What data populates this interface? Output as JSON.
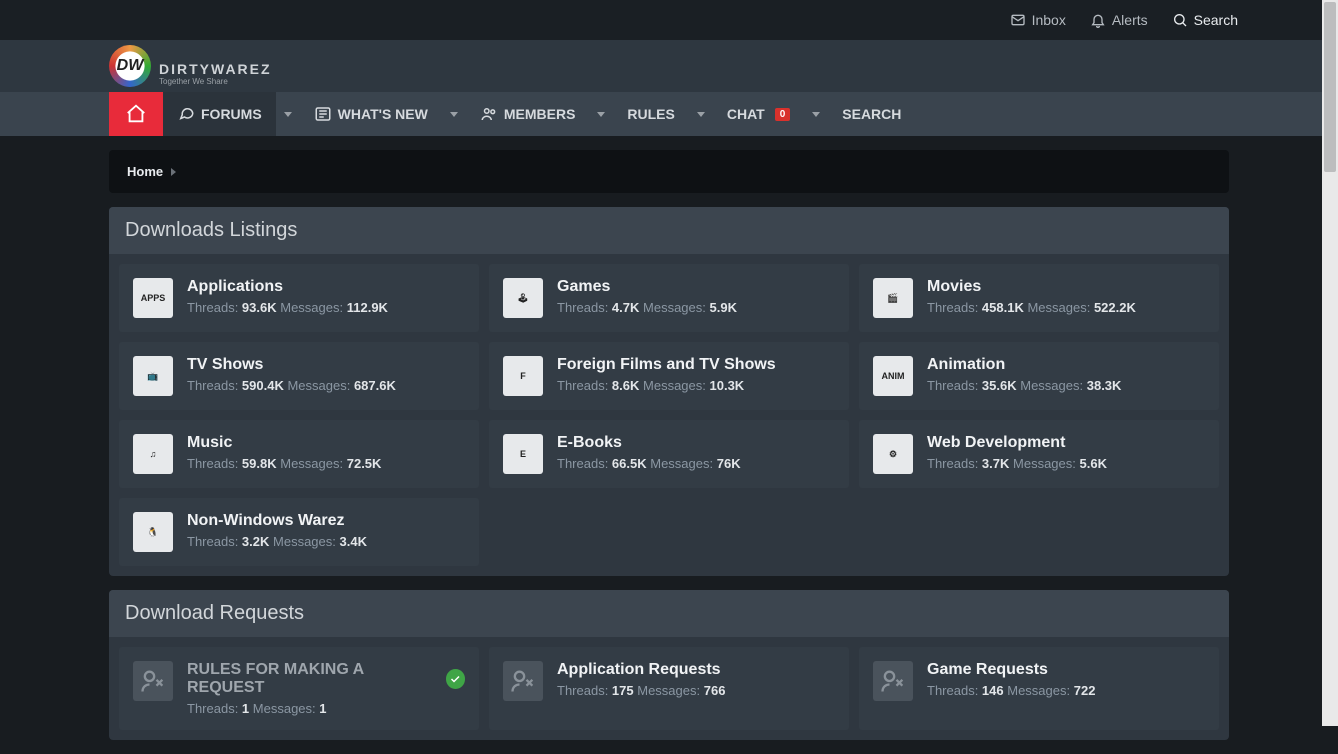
{
  "topbar": {
    "inbox": "Inbox",
    "alerts": "Alerts",
    "search": "Search"
  },
  "brand": {
    "initials": "DW",
    "name": "DIRTYWAREZ",
    "tagline": "Together We Share"
  },
  "nav": {
    "forums": "FORUMS",
    "whats_new": "WHAT'S NEW",
    "members": "MEMBERS",
    "rules": "RULES",
    "chat": "CHAT",
    "chat_count": "0",
    "search": "SEARCH"
  },
  "breadcrumb": {
    "home": "Home"
  },
  "sections": {
    "downloads_listings": "Downloads Listings",
    "download_requests": "Download Requests"
  },
  "labels": {
    "threads": "Threads:",
    "messages": "Messages:"
  },
  "listings": [
    {
      "title": "Applications",
      "threads": "93.6K",
      "messages": "112.9K",
      "icon": "APPS"
    },
    {
      "title": "Games",
      "threads": "4.7K",
      "messages": "5.9K",
      "icon": "🕹"
    },
    {
      "title": "Movies",
      "threads": "458.1K",
      "messages": "522.2K",
      "icon": "🎬"
    },
    {
      "title": "TV Shows",
      "threads": "590.4K",
      "messages": "687.6K",
      "icon": "📺"
    },
    {
      "title": "Foreign Films and TV Shows",
      "threads": "8.6K",
      "messages": "10.3K",
      "icon": "F"
    },
    {
      "title": "Animation",
      "threads": "35.6K",
      "messages": "38.3K",
      "icon": "ANIM"
    },
    {
      "title": "Music",
      "threads": "59.8K",
      "messages": "72.5K",
      "icon": "♫"
    },
    {
      "title": "E-Books",
      "threads": "66.5K",
      "messages": "76K",
      "icon": "E"
    },
    {
      "title": "Web Development",
      "threads": "3.7K",
      "messages": "5.6K",
      "icon": "⚙"
    },
    {
      "title": "Non-Windows Warez",
      "threads": "3.2K",
      "messages": "3.4K",
      "icon": "🐧"
    }
  ],
  "requests": [
    {
      "title": "RULES FOR MAKING A REQUEST",
      "threads": "1",
      "messages": "1",
      "badge": true
    },
    {
      "title": "Application Requests",
      "threads": "175",
      "messages": "766",
      "badge": false
    },
    {
      "title": "Game Requests",
      "threads": "146",
      "messages": "722",
      "badge": false
    }
  ]
}
